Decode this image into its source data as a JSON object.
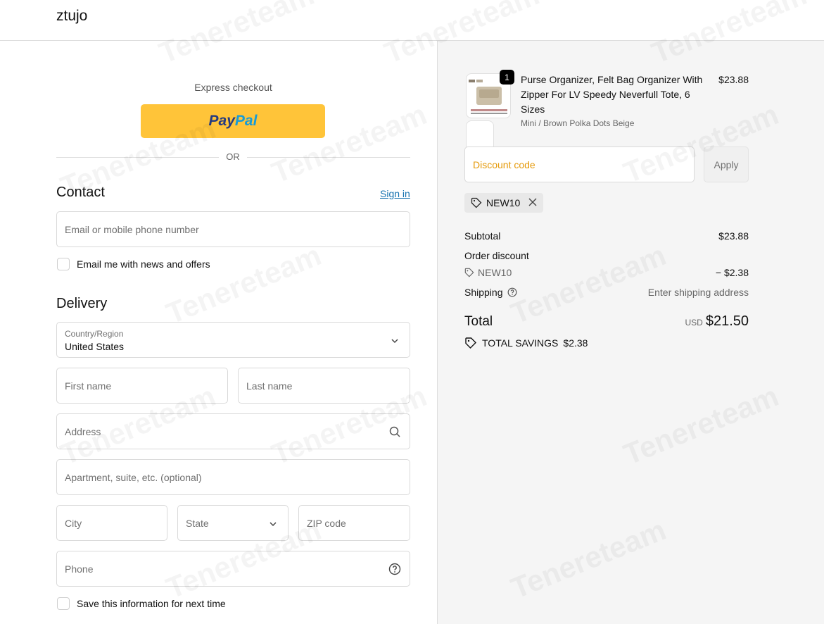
{
  "header": {
    "brand": "ztujo"
  },
  "express": {
    "label": "Express checkout",
    "paypal_pay": "Pay",
    "paypal_pal": "Pal",
    "or": "OR"
  },
  "contact": {
    "title": "Contact",
    "sign_in": "Sign in",
    "email_placeholder": "Email or mobile phone number",
    "news_label": "Email me with news and offers"
  },
  "delivery": {
    "title": "Delivery",
    "country_label": "Country/Region",
    "country_value": "United States",
    "first_name_placeholder": "First name",
    "last_name_placeholder": "Last name",
    "address_placeholder": "Address",
    "apartment_placeholder": "Apartment, suite, etc. (optional)",
    "city_placeholder": "City",
    "state_placeholder": "State",
    "zip_placeholder": "ZIP code",
    "phone_placeholder": "Phone",
    "save_label": "Save this information for next time"
  },
  "summary": {
    "product": {
      "quantity": "1",
      "title": "Purse Organizer, Felt Bag Organizer With Zipper For LV Speedy Neverfull Tote, 6 Sizes",
      "variant": "Mini / Brown Polka Dots Beige",
      "price": "$23.88"
    },
    "discount_placeholder": "Discount code",
    "apply_label": "Apply",
    "applied_code": "NEW10",
    "subtotal_label": "Subtotal",
    "subtotal_value": "$23.88",
    "order_discount_label": "Order discount",
    "discount_code": "NEW10",
    "discount_value": "− $2.38",
    "shipping_label": "Shipping",
    "shipping_value": "Enter shipping address",
    "total_label": "Total",
    "currency": "USD",
    "total_value": "$21.50",
    "savings_label": "TOTAL SAVINGS",
    "savings_value": "$2.38"
  },
  "watermark": "Tenereteam",
  "colors": {
    "paypal_yellow": "#ffc439",
    "link_blue": "#1773b0",
    "discount_placeholder": "#e59a0a"
  }
}
